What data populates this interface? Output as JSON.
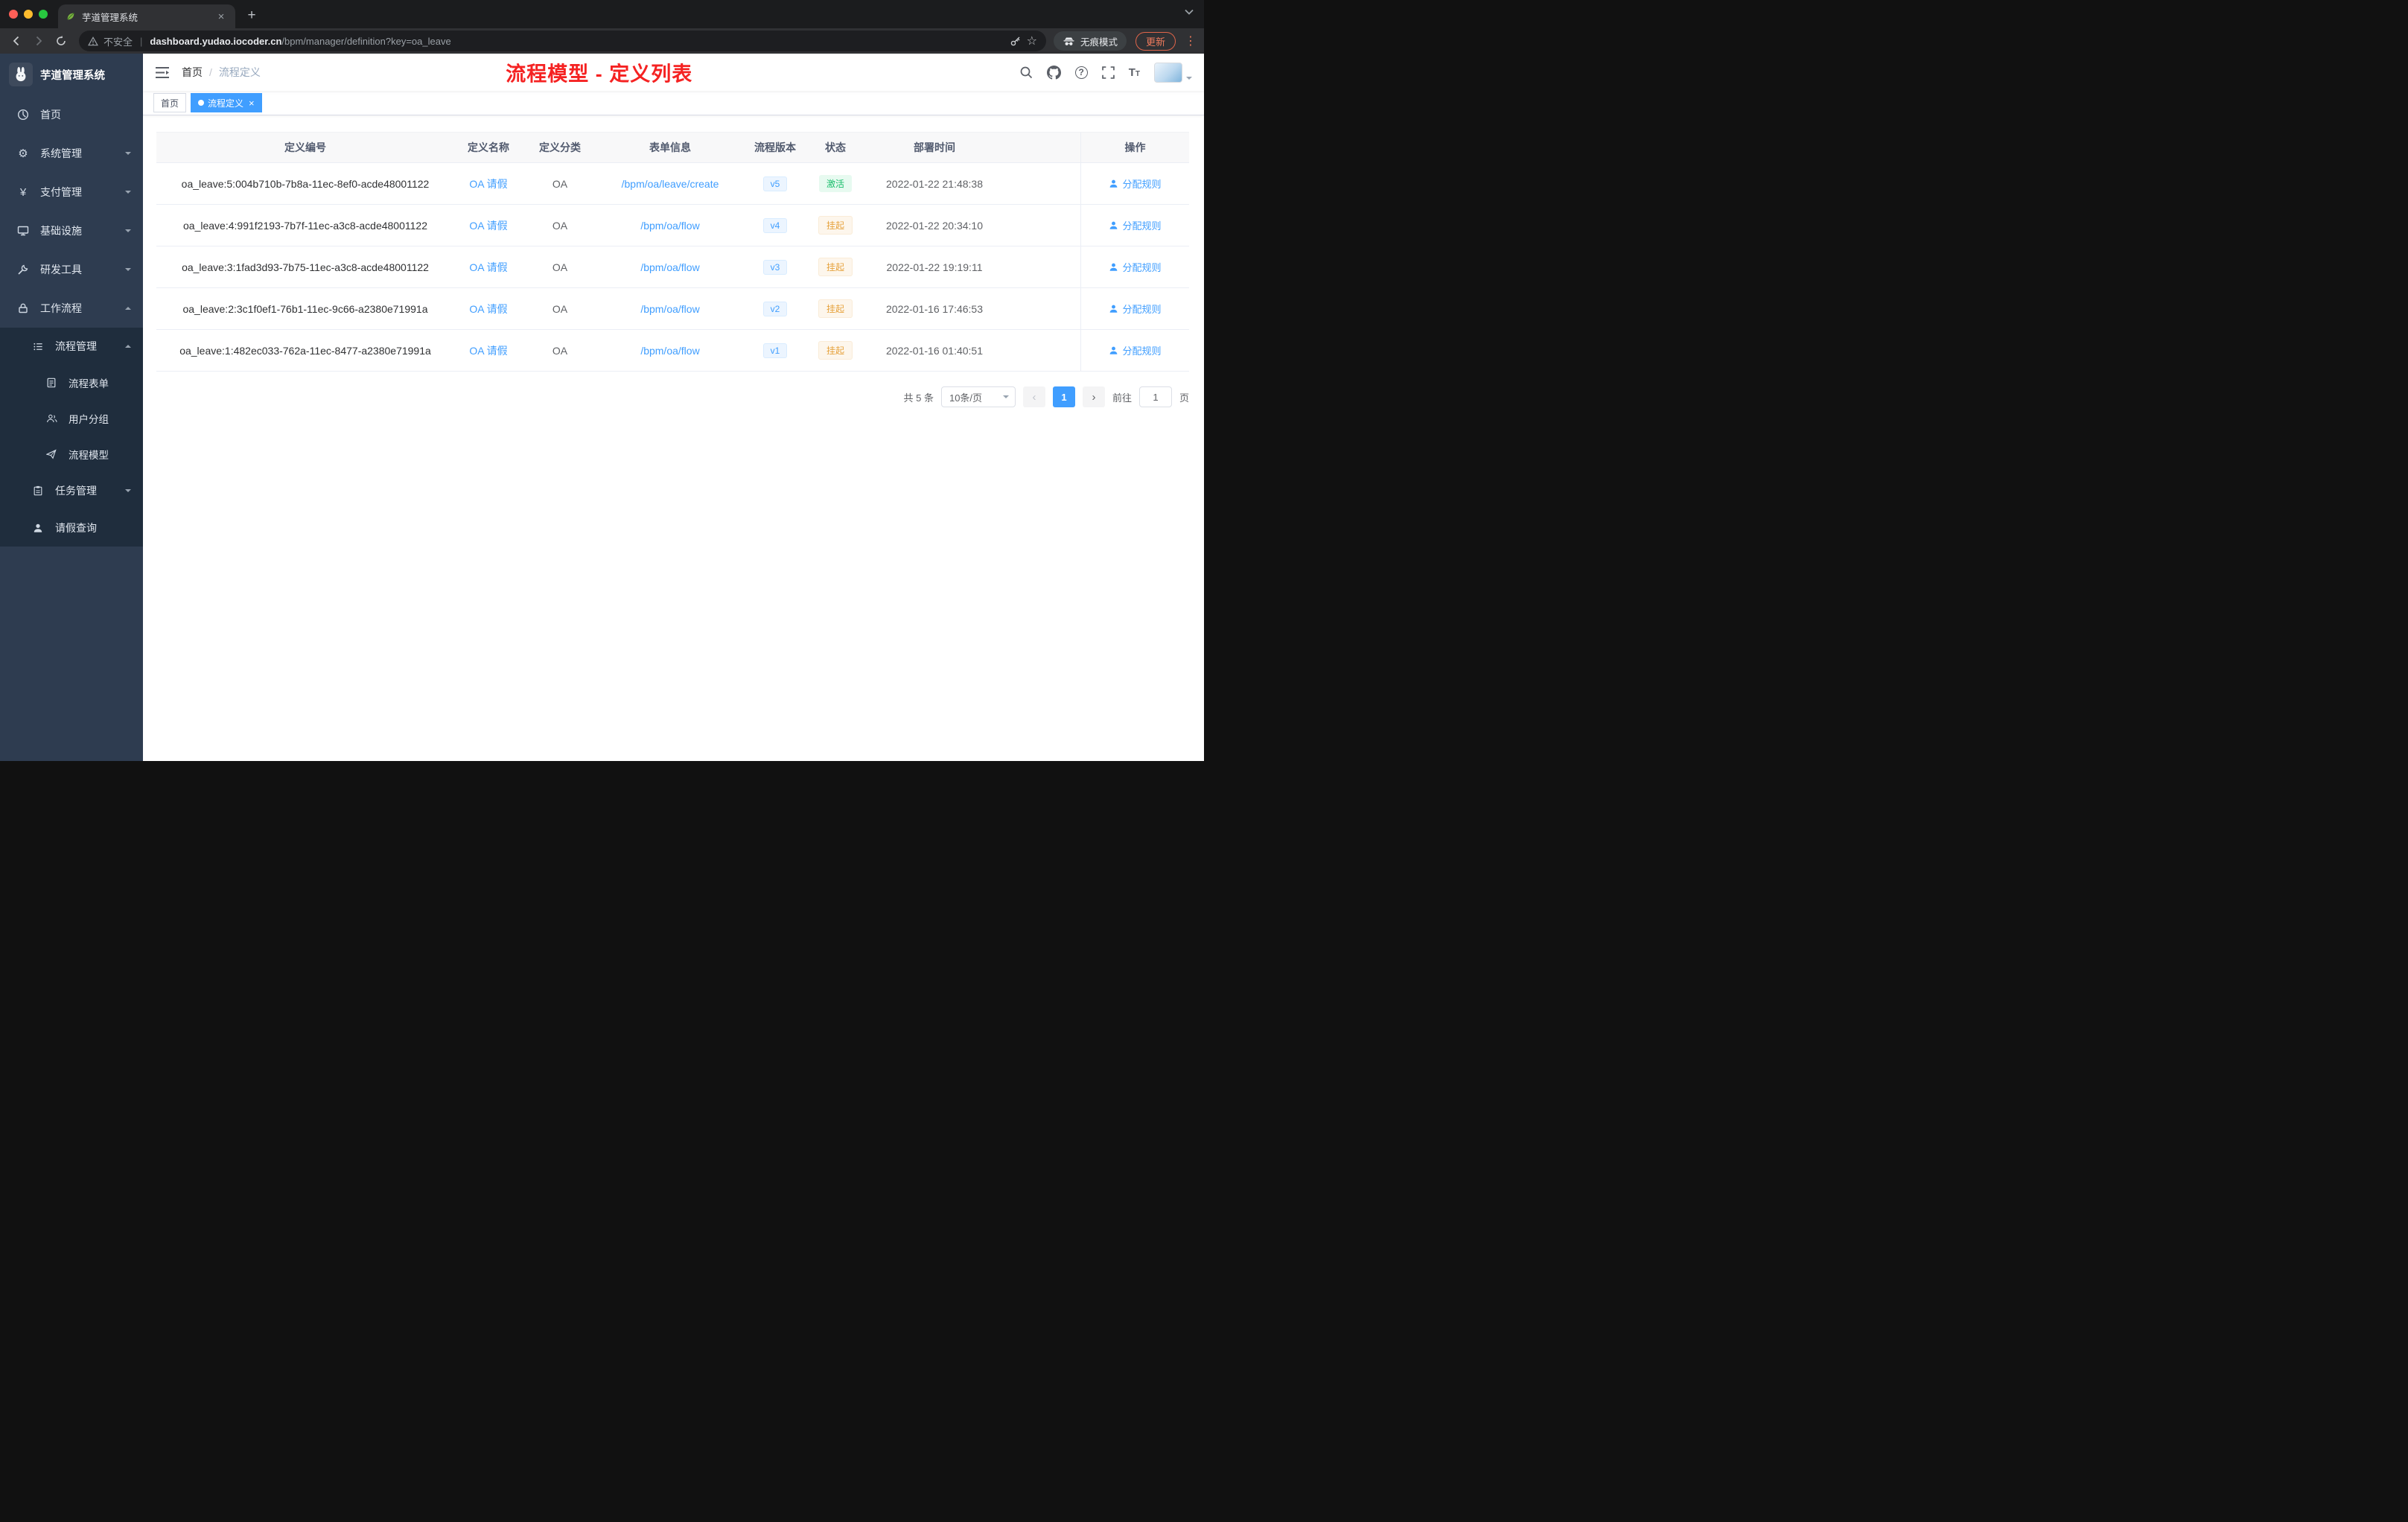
{
  "colors": {
    "accent": "#409eff",
    "success": "#19be6b",
    "warning": "#e6a23c",
    "annotation": "#f52222",
    "sidebar_bg": "#2e3c50",
    "submenu_bg": "#1f2d3d"
  },
  "browser": {
    "tab_title": "芋道管理系统",
    "security_label": "不安全",
    "url_host": "dashboard.yudao.iocoder.cn",
    "url_path": "/bpm/manager/definition?key=oa_leave",
    "incognito_label": "无痕模式",
    "update_label": "更新"
  },
  "sidebar": {
    "logo_title": "芋道管理系统",
    "menu": [
      {
        "label": "首页"
      },
      {
        "label": "系统管理"
      },
      {
        "label": "支付管理"
      },
      {
        "label": "基础设施"
      },
      {
        "label": "研发工具"
      },
      {
        "label": "工作流程"
      }
    ],
    "submenu": {
      "process_mgmt": "流程管理",
      "children": [
        {
          "label": "流程表单"
        },
        {
          "label": "用户分组"
        },
        {
          "label": "流程模型"
        }
      ],
      "task_mgmt": "任务管理",
      "leave_query": "请假查询"
    }
  },
  "header": {
    "breadcrumb_home": "首页",
    "breadcrumb_sep": "/",
    "breadcrumb_current": "流程定义",
    "annotation": "流程模型 - 定义列表"
  },
  "tags": [
    {
      "label": "首页"
    },
    {
      "label": "流程定义"
    }
  ],
  "table": {
    "columns": [
      "定义编号",
      "定义名称",
      "定义分类",
      "表单信息",
      "流程版本",
      "状态",
      "部署时间",
      "操作"
    ],
    "rows": [
      {
        "id": "oa_leave:5:004b710b-7b8a-11ec-8ef0-acde48001122",
        "name": "OA 请假",
        "category": "OA",
        "form": "/bpm/oa/leave/create",
        "version": "v5",
        "status": "激活",
        "time": "2022-01-22 21:48:38",
        "action": "分配规则"
      },
      {
        "id": "oa_leave:4:991f2193-7b7f-11ec-a3c8-acde48001122",
        "name": "OA 请假",
        "category": "OA",
        "form": "/bpm/oa/flow",
        "version": "v4",
        "status": "挂起",
        "time": "2022-01-22 20:34:10",
        "action": "分配规则"
      },
      {
        "id": "oa_leave:3:1fad3d93-7b75-11ec-a3c8-acde48001122",
        "name": "OA 请假",
        "category": "OA",
        "form": "/bpm/oa/flow",
        "version": "v3",
        "status": "挂起",
        "time": "2022-01-22 19:19:11",
        "action": "分配规则"
      },
      {
        "id": "oa_leave:2:3c1f0ef1-76b1-11ec-9c66-a2380e71991a",
        "name": "OA 请假",
        "category": "OA",
        "form": "/bpm/oa/flow",
        "version": "v2",
        "status": "挂起",
        "time": "2022-01-16 17:46:53",
        "action": "分配规则"
      },
      {
        "id": "oa_leave:1:482ec033-762a-11ec-8477-a2380e71991a",
        "name": "OA 请假",
        "category": "OA",
        "form": "/bpm/oa/flow",
        "version": "v1",
        "status": "挂起",
        "time": "2022-01-16 01:40:51",
        "action": "分配规则"
      }
    ]
  },
  "pagination": {
    "total": "共 5 条",
    "page_size": "10条/页",
    "prev": "‹",
    "current": "1",
    "next": "›",
    "goto_prefix": "前往",
    "goto_value": "1",
    "goto_suffix": "页"
  }
}
